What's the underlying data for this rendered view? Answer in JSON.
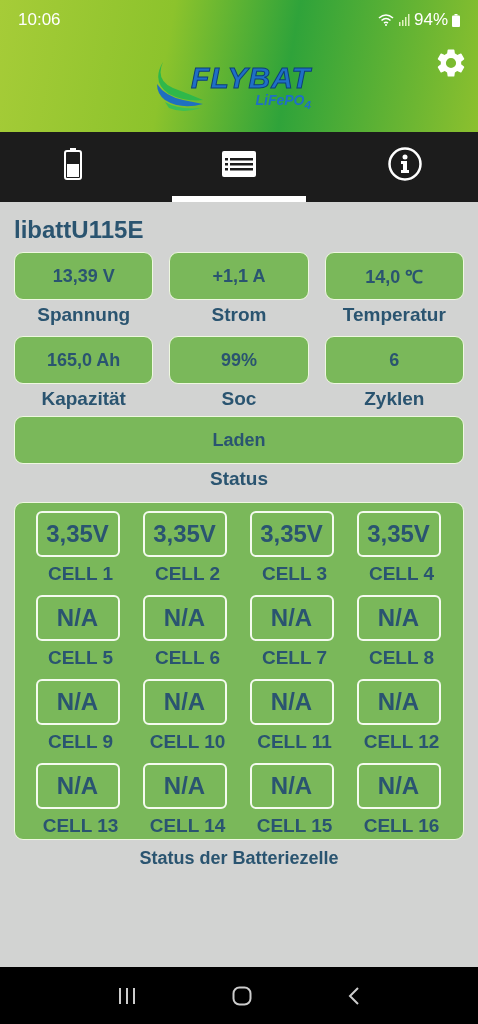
{
  "status_bar": {
    "time": "10:06",
    "battery": "94%"
  },
  "header": {
    "logo_text": "FLYBAT",
    "logo_subtext": "LiFePO$_{4}$"
  },
  "tabs": [
    {
      "kind": "battery",
      "selected": false
    },
    {
      "kind": "list",
      "selected": true
    },
    {
      "kind": "info",
      "selected": false
    }
  ],
  "device_name": "libattU115E",
  "metrics": [
    {
      "value": "13,39 V",
      "label": "Spannung"
    },
    {
      "value": "+1,1 A",
      "label": "Strom"
    },
    {
      "value": "14,0 ℃",
      "label": "Temperatur"
    },
    {
      "value": "165,0 Ah",
      "label": "Kapazität"
    },
    {
      "value": "99%",
      "label": "Soc"
    },
    {
      "value": "6",
      "label": "Zyklen"
    }
  ],
  "status": {
    "value": "Laden",
    "label": "Status"
  },
  "cells": [
    {
      "value": "3,35V",
      "label": "CELL 1"
    },
    {
      "value": "3,35V",
      "label": "CELL 2"
    },
    {
      "value": "3,35V",
      "label": "CELL 3"
    },
    {
      "value": "3,35V",
      "label": "CELL 4"
    },
    {
      "value": "N/A",
      "label": "CELL 5"
    },
    {
      "value": "N/A",
      "label": "CELL 6"
    },
    {
      "value": "N/A",
      "label": "CELL 7"
    },
    {
      "value": "N/A",
      "label": "CELL 8"
    },
    {
      "value": "N/A",
      "label": "CELL 9"
    },
    {
      "value": "N/A",
      "label": "CELL 10"
    },
    {
      "value": "N/A",
      "label": "CELL 11"
    },
    {
      "value": "N/A",
      "label": "CELL 12"
    },
    {
      "value": "N/A",
      "label": "CELL 13"
    },
    {
      "value": "N/A",
      "label": "CELL 14"
    },
    {
      "value": "N/A",
      "label": "CELL 15"
    },
    {
      "value": "N/A",
      "label": "CELL 16"
    }
  ],
  "cells_label": "Status der Batteriezelle"
}
